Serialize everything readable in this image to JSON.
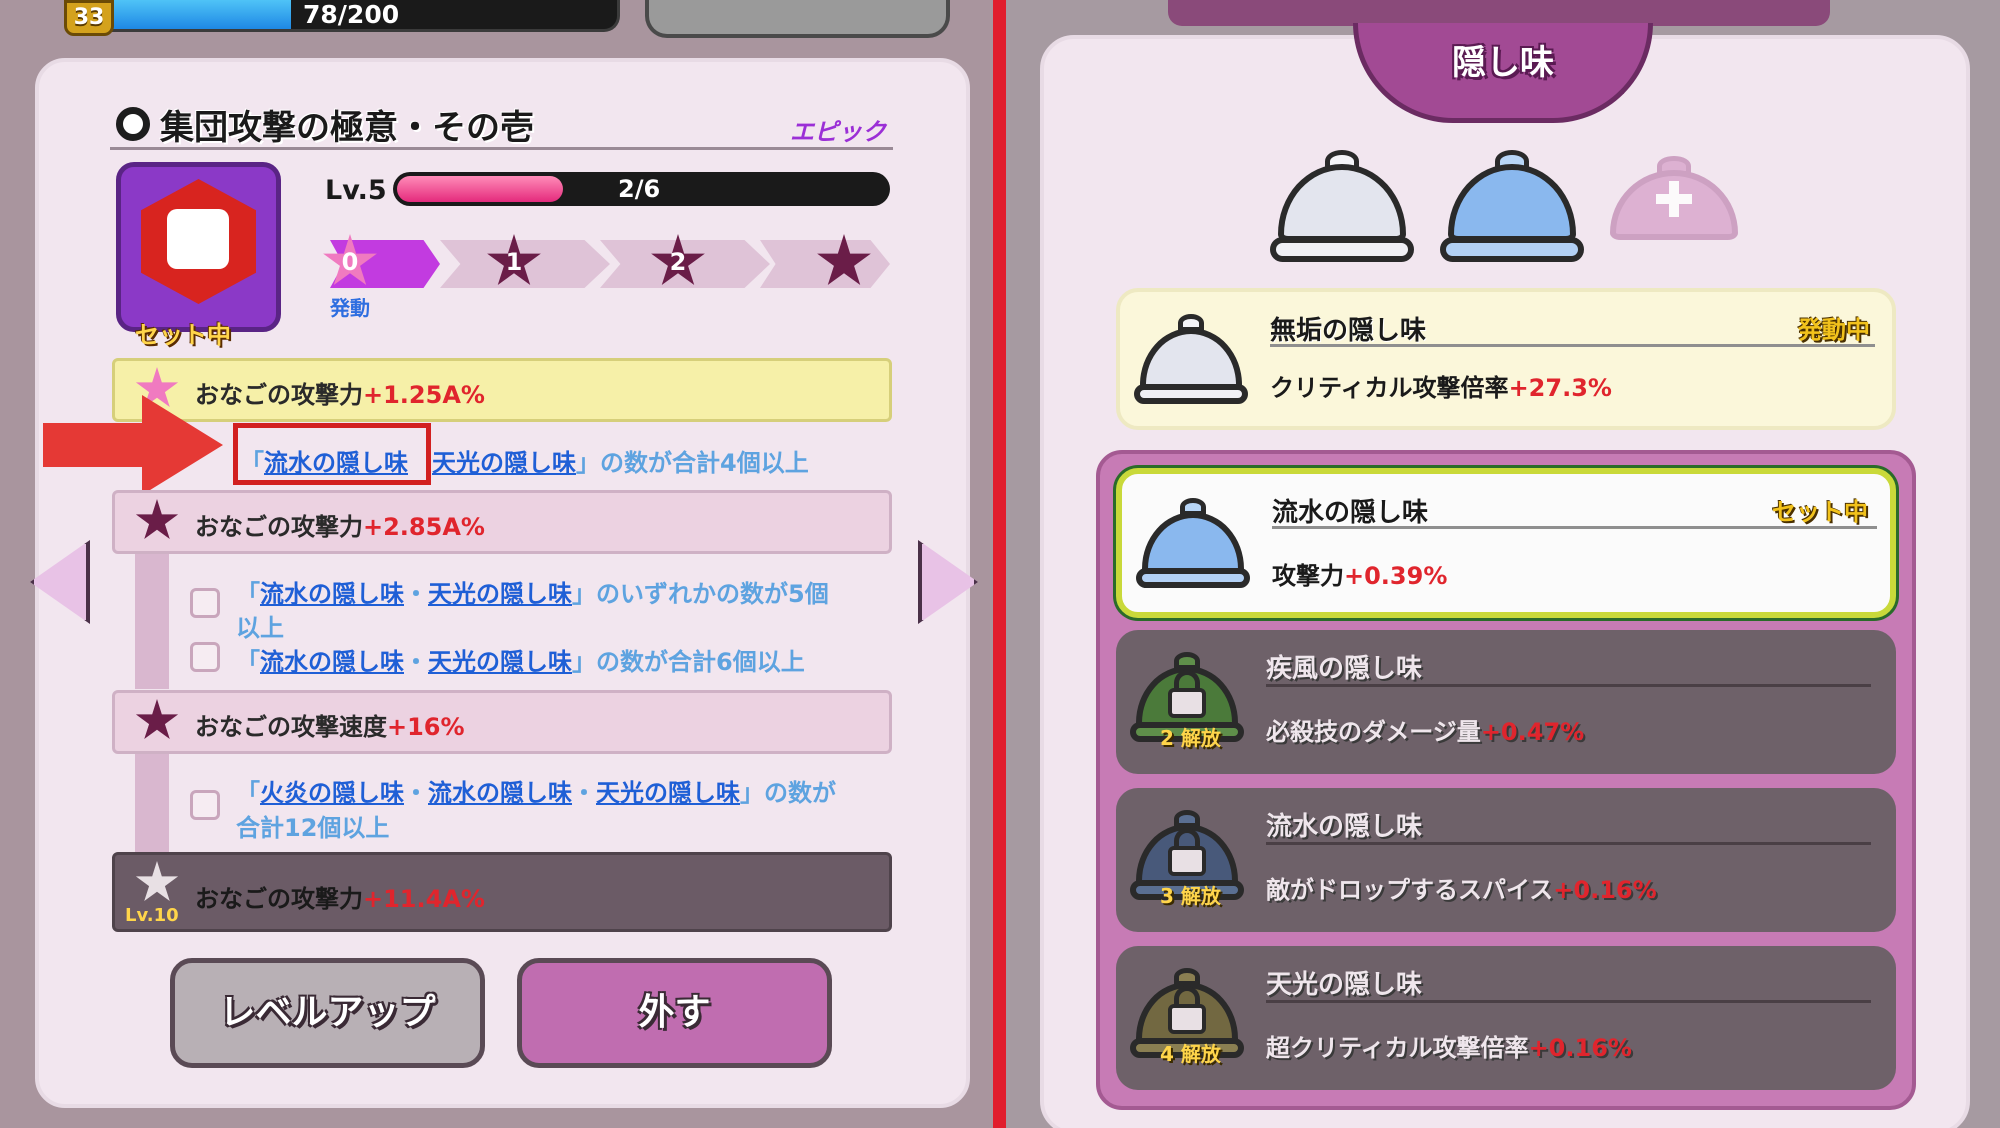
{
  "left": {
    "player_level": "33",
    "xp_text": "78/200",
    "xp_fraction": 0.39,
    "skill_title": "集団攻撃の極意・その壱",
    "rarity": "エピック",
    "set_label": "セット中",
    "level_label": "Lv.5",
    "progress_text": "2/6",
    "progress_fraction": 0.333,
    "steps": [
      "0",
      "1",
      "2"
    ],
    "activation_label": "発動",
    "rows": [
      {
        "star": "0",
        "label": "おなごの攻撃力",
        "value": "+1.25A%"
      },
      {
        "star": "1",
        "label": "おなごの攻撃力",
        "value": "+2.85A%"
      },
      {
        "star": "2",
        "label": "おなごの攻撃速度",
        "value": "+16%"
      },
      {
        "star": "Lv.10",
        "label": "おなごの攻撃力",
        "value": "+11.4A%"
      }
    ],
    "conditions": [
      {
        "open": "「",
        "link1": "流水の隠し味",
        "sep": "・",
        "link2": "天光の隠し味",
        "rest": "」の数が合計4個以上"
      },
      {
        "open": "「",
        "link1": "流水の隠し味",
        "sep": "・",
        "link2": "天光の隠し味",
        "rest": "」のいずれかの数が5個",
        "rest2": "以上"
      },
      {
        "open": "「",
        "link1": "流水の隠し味",
        "sep": "・",
        "link2": "天光の隠し味",
        "rest": "」の数が合計6個以上"
      },
      {
        "open": "「",
        "link1": "火炎の隠し味",
        "sep": "・",
        "link2": "流水の隠し味",
        "sep2": "・",
        "link3": "天光の隠し味",
        "rest": "」の数が",
        "rest2": "合計12個以上"
      }
    ],
    "btn_levelup": "レベルアップ",
    "btn_remove": "外す"
  },
  "right": {
    "header": "隠し味",
    "rows": [
      {
        "name": "無垢の隠し味",
        "stat_label": "クリティカル攻撃倍率",
        "stat_value": "+27.3%",
        "tag": "発動中"
      },
      {
        "name": "流水の隠し味",
        "stat_label": "攻撃力",
        "stat_value": "+0.39%",
        "tag": "セット中"
      },
      {
        "name": "疾風の隠し味",
        "stat_label": "必殺技のダメージ量",
        "stat_value": "+0.47%",
        "unlock": "2",
        "unlock_label": "解放"
      },
      {
        "name": "流水の隠し味",
        "stat_label": "敵がドロップするスパイス",
        "stat_value": "+0.16%",
        "unlock": "3",
        "unlock_label": "解放"
      },
      {
        "name": "天光の隠し味",
        "stat_label": "超クリティカル攻撃倍率",
        "stat_value": "+0.16%",
        "unlock": "4",
        "unlock_label": "解放"
      }
    ]
  },
  "colors": {
    "accent_red": "#e53935",
    "stat_red": "#e0252d",
    "link_blue": "#1f5fd6",
    "tag_yellow": "#f2c21b"
  }
}
